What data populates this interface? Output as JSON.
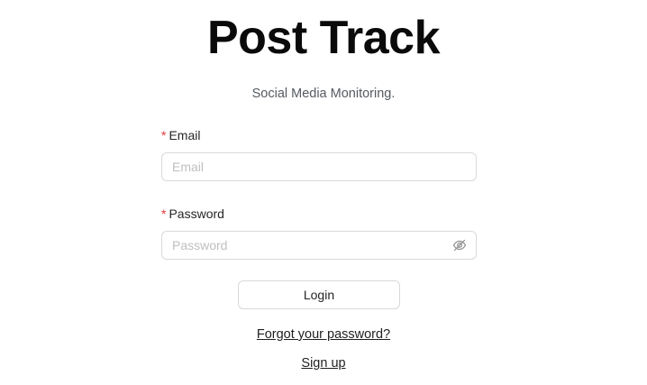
{
  "app": {
    "title": "Post Track",
    "subtitle": "Social Media Monitoring."
  },
  "form": {
    "email": {
      "required_marker": "*",
      "label": "Email",
      "placeholder": "Email",
      "value": ""
    },
    "password": {
      "required_marker": "*",
      "label": "Password",
      "placeholder": "Password",
      "value": "",
      "visibility_icon": "eye-invisible-icon"
    },
    "login_label": "Login"
  },
  "links": {
    "forgot_password": "Forgot your password?",
    "sign_up": "Sign up"
  },
  "colors": {
    "required": "#e0363b",
    "border": "#d9d9d9",
    "placeholder": "#bfbfbf",
    "title": "#0a0a0a"
  }
}
